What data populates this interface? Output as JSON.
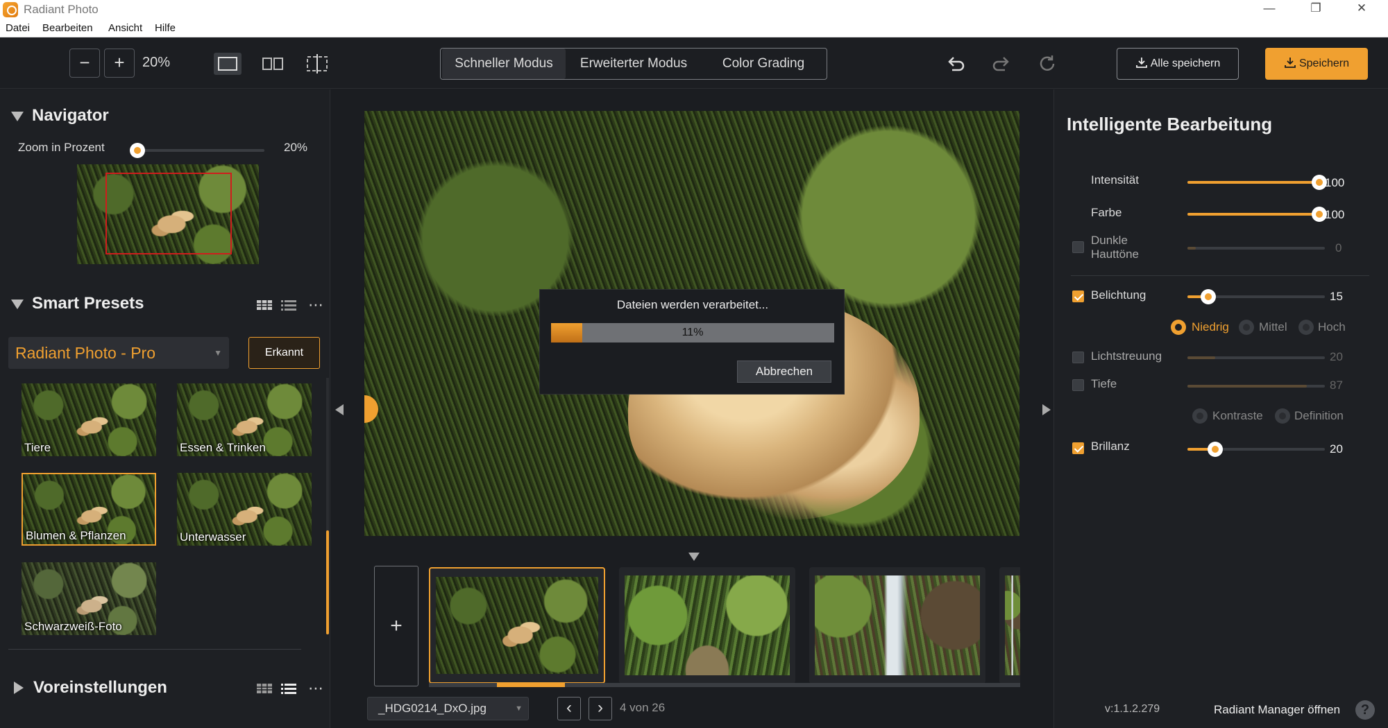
{
  "window": {
    "title": "Radiant Photo",
    "controls": [
      "—",
      "❐",
      "✕"
    ]
  },
  "menu": [
    "Datei",
    "Bearbeiten",
    "Ansicht",
    "Hilfe"
  ],
  "toolbar": {
    "zoom_out": "−",
    "zoom_in": "+",
    "zoom_value": "20%",
    "modes": [
      "Schneller Modus",
      "Erweiterter Modus",
      "Color Grading"
    ],
    "save_all": "Alle speichern",
    "save": "Speichern"
  },
  "navigator": {
    "title": "Navigator",
    "zoom_label": "Zoom in Prozent",
    "zoom_value": "20%",
    "zoom_level": 0.05
  },
  "smart_presets": {
    "title": "Smart Presets",
    "selected_preset": "Radiant Photo - Pro",
    "detect_button": "Erkannt",
    "presets": [
      "Tiere",
      "Essen & Trinken",
      "Blumen & Pflanzen",
      "Unterwasser",
      "Schwarzweiß-Foto"
    ]
  },
  "voreinstellungen": {
    "title": "Voreinstellungen"
  },
  "dialog": {
    "title": "Dateien werden verarbeitet...",
    "progress_text": "11%",
    "progress": 0.11,
    "cancel": "Abbrechen"
  },
  "filmstrip": {
    "add": "+",
    "file_name": "_HDG0214_DxO.jpg",
    "page_info": "4 von 26",
    "prev": "‹",
    "next": "›"
  },
  "smart_edit": {
    "title": "Intelligente Bearbeitung",
    "intensity": {
      "label": "Intensität",
      "value": "100",
      "level": 1.0
    },
    "color": {
      "label": "Farbe",
      "value": "100",
      "level": 1.0
    },
    "skin": {
      "label_line1": "Dunkle",
      "label_line2": "Hauttöne",
      "value": "0",
      "level": 0.0
    },
    "exposure": {
      "label": "Belichtung",
      "value": "15",
      "level": 0.15,
      "options": [
        "Niedrig",
        "Mittel",
        "Hoch"
      ]
    },
    "scatter": {
      "label": "Lichtstreuung",
      "value": "20",
      "level": 0.2
    },
    "depth": {
      "label": "Tiefe",
      "value": "87",
      "level": 0.87,
      "options": [
        "Kontraste",
        "Definition"
      ]
    },
    "brilliance": {
      "label": "Brillanz",
      "value": "20",
      "level": 0.2
    }
  },
  "footer": {
    "version": "v:1.1.2.279",
    "manager": "Radiant Manager öffnen",
    "help": "?"
  },
  "colors": {
    "accent": "#f0a030",
    "panel": "#1e2024",
    "background": "#1c1e22"
  }
}
